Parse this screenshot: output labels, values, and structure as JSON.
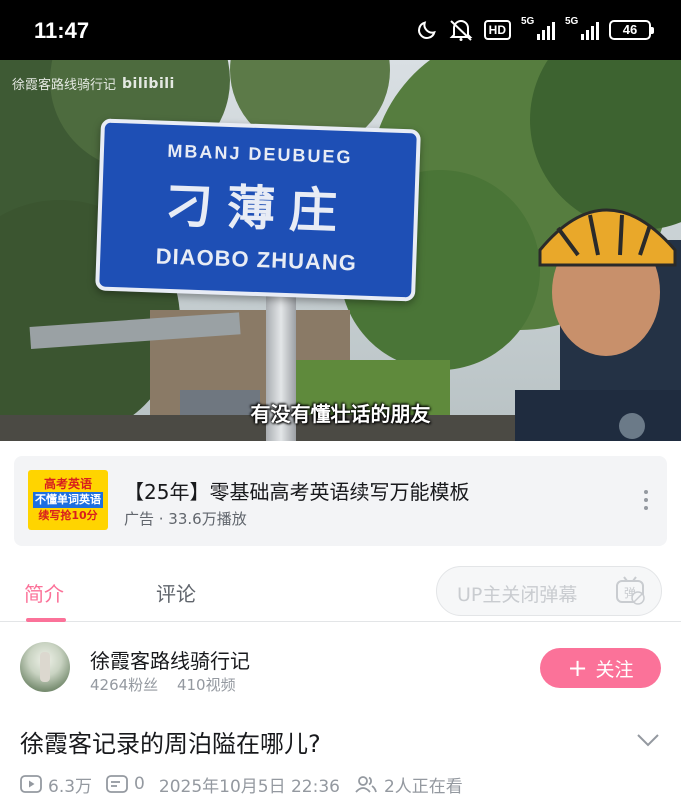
{
  "status_bar": {
    "time": "11:47",
    "hd_badge": "HD",
    "network_1": "5G",
    "network_2": "5G",
    "battery_level": "46",
    "icons": [
      "moon-icon",
      "mute-icon",
      "hd-icon",
      "signal-icon",
      "signal-icon",
      "battery-icon"
    ]
  },
  "video": {
    "watermark_channel": "徐霞客路线骑行记",
    "watermark_brand": "bilibili",
    "sign_line1": "MBANJ DEUBUEG",
    "sign_line2": "刁薄庄",
    "sign_line3": "DIAOBO ZHUANG",
    "subtitle": "有没有懂壮话的朋友"
  },
  "ad": {
    "thumb_line1": "高考英语",
    "thumb_line2": "不懂单词英语",
    "thumb_line3": "续写抢10分",
    "title": "【25年】零基础高考英语续写万能模板",
    "meta": "广告 · 33.6万播放"
  },
  "tabs": {
    "intro": "简介",
    "comments": "评论",
    "danmaku_label": "UP主关闭弹幕",
    "danmaku_icon_text": "弹"
  },
  "uploader": {
    "name": "徐霞客路线骑行记",
    "fans": "4264粉丝",
    "videos": "410视频",
    "follow_label": "关注"
  },
  "video_info": {
    "title": "徐霞客记录的周泊隘在哪儿?",
    "views": "6.3万",
    "danmaku_count": "0",
    "date": "2025年10月5日 22:36",
    "watching": "2人正在看"
  },
  "colors": {
    "accent_pink": "#fb7299",
    "sign_blue": "#1e4fb5",
    "muted_text": "#9499a0"
  }
}
